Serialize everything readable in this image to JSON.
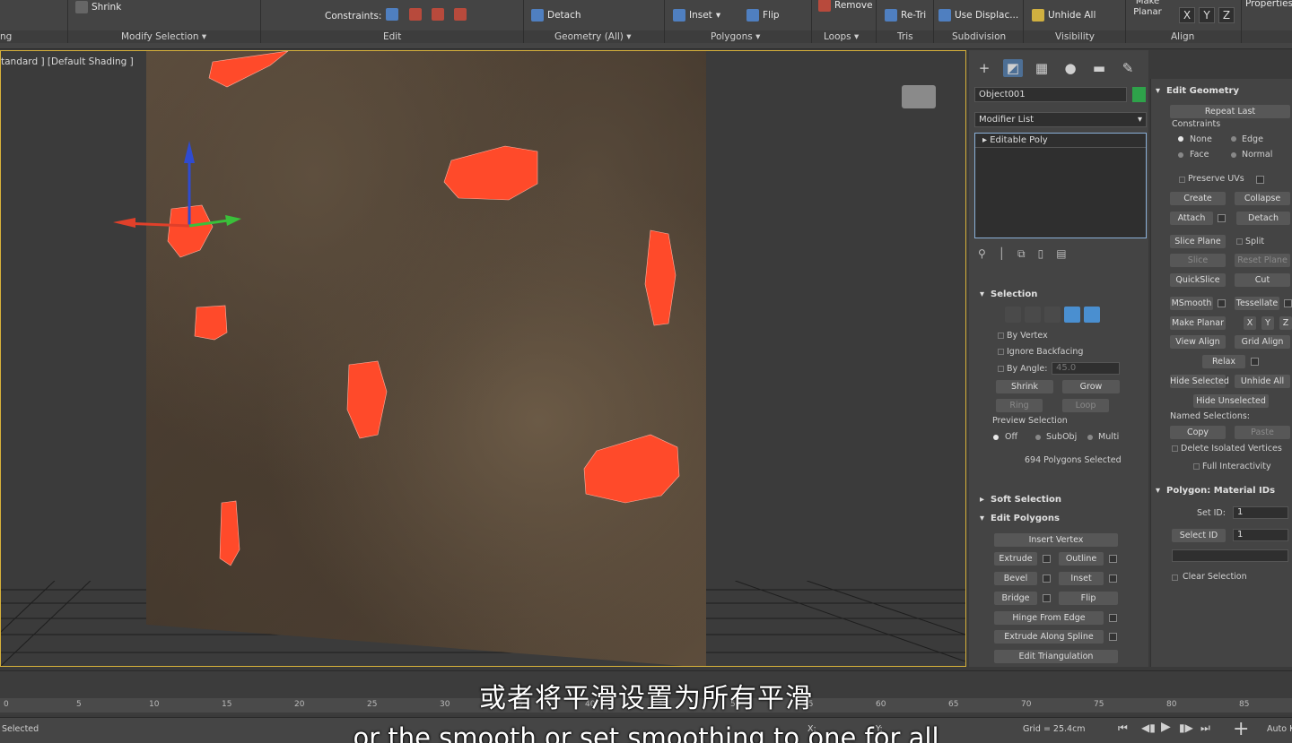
{
  "ribbon": {
    "buttons": {
      "shrink": "Shrink",
      "constraints": "Constraints:",
      "detach": "Detach",
      "inset": "Inset",
      "flip": "Flip",
      "remove": "Remove",
      "retri": "Re-Tri",
      "use_displace": "Use Displac...",
      "unhide_all": "Unhide All",
      "make_planar": "Make Planar",
      "x": "X",
      "y": "Y",
      "z": "Z",
      "properties": "Properties"
    },
    "groups": {
      "g0": "ng",
      "modify_selection": "Modify Selection",
      "edit": "Edit",
      "geometry_all": "Geometry (All)",
      "polygons": "Polygons",
      "loops": "Loops",
      "tris": "Tris",
      "subdivision": "Subdivision",
      "visibility": "Visibility",
      "align": "Align"
    }
  },
  "viewport": {
    "label": "tandard ] [Default Shading ]"
  },
  "command_panel": {
    "object_name": "Object001",
    "object_color": "#2ea24a",
    "modifier_list": "Modifier List",
    "stack_item": "Editable Poly",
    "selection": {
      "title": "Selection",
      "by_vertex": "By Vertex",
      "ignore_backfacing": "Ignore Backfacing",
      "by_angle": "By Angle:",
      "angle_value": "45.0",
      "shrink": "Shrink",
      "grow": "Grow",
      "ring": "Ring",
      "loop": "Loop",
      "preview_selection": "Preview Selection",
      "off": "Off",
      "subobj": "SubObj",
      "multi": "Multi",
      "count_text": "694 Polygons Selected"
    },
    "soft_selection": "Soft Selection",
    "edit_polygons": {
      "title": "Edit Polygons",
      "insert_vertex": "Insert Vertex",
      "extrude": "Extrude",
      "outline": "Outline",
      "bevel": "Bevel",
      "inset": "Inset",
      "bridge": "Bridge",
      "flip": "Flip",
      "hinge": "Hinge From Edge",
      "extrude_spline": "Extrude Along Spline",
      "edit_triangulation": "Edit Triangulation"
    }
  },
  "edit_geometry": {
    "title": "Edit Geometry",
    "repeat_last": "Repeat Last",
    "constraints": "Constraints",
    "none": "None",
    "edge": "Edge",
    "face": "Face",
    "normal": "Normal",
    "preserve_uvs": "Preserve UVs",
    "create": "Create",
    "collapse": "Collapse",
    "attach": "Attach",
    "detach": "Detach",
    "slice_plane": "Slice Plane",
    "split": "Split",
    "slice": "Slice",
    "reset_plane": "Reset Plane",
    "quickslice": "QuickSlice",
    "cut": "Cut",
    "msmooth": "MSmooth",
    "tessellate": "Tessellate",
    "make_planar": "Make Planar",
    "x": "X",
    "y": "Y",
    "z": "Z",
    "view_align": "View Align",
    "grid_align": "Grid Align",
    "relax": "Relax",
    "hide_selected": "Hide Selected",
    "unhide_all": "Unhide All",
    "hide_unselected": "Hide Unselected",
    "named_selections": "Named Selections:",
    "copy": "Copy",
    "paste": "Paste",
    "delete_isolated": "Delete Isolated Vertices",
    "full_interactivity": "Full Interactivity"
  },
  "material_ids": {
    "title": "Polygon: Material IDs",
    "set_id": "Set ID:",
    "set_id_value": "1",
    "select_id": "Select ID",
    "select_id_value": "1",
    "clear_selection": "Clear Selection"
  },
  "timeline": {
    "ticks": [
      "0",
      "5",
      "10",
      "15",
      "20",
      "25",
      "30",
      "35",
      "40",
      "45",
      "50",
      "55",
      "60",
      "65",
      "70",
      "75",
      "80",
      "85"
    ]
  },
  "status": {
    "selected": "Selected",
    "grid": "Grid = 25.4cm",
    "x_label": "X:",
    "y_label": "Y:",
    "auto": "Auto K"
  },
  "subtitles": {
    "zh": "或者将平滑设置为所有平滑",
    "en": "or the smooth or set smoothing to one for all"
  }
}
